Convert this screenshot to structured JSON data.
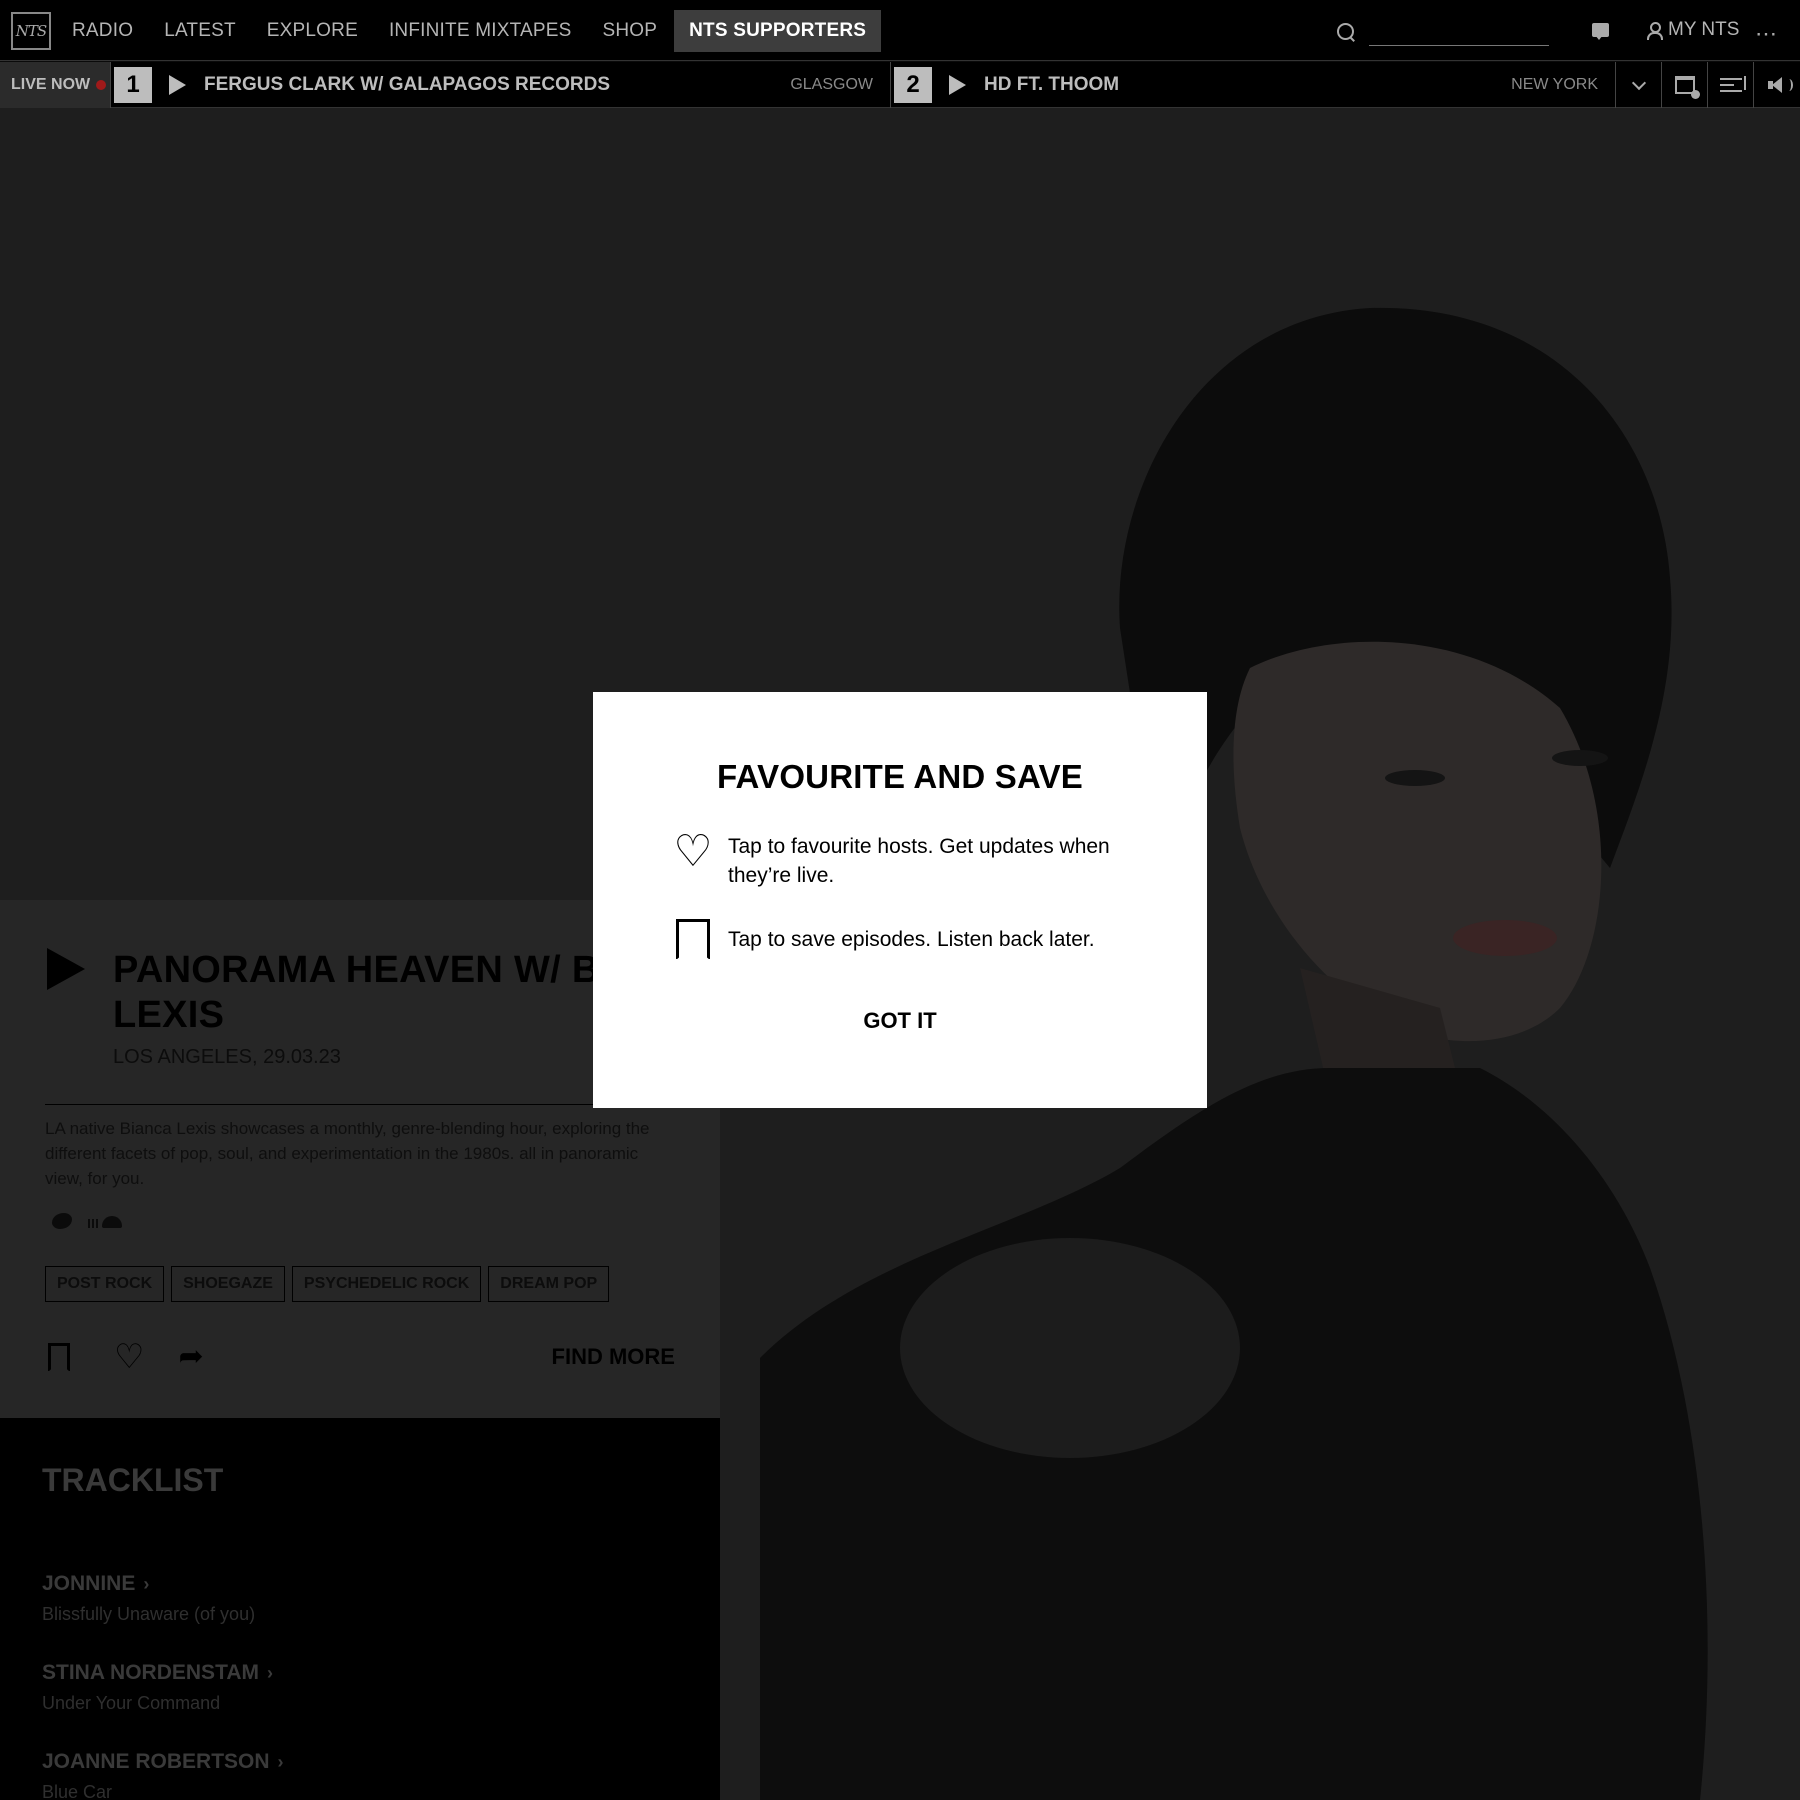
{
  "nav": {
    "logo_text": "NTS",
    "links": [
      "RADIO",
      "LATEST",
      "EXPLORE",
      "INFINITE MIXTAPES",
      "SHOP"
    ],
    "supporters_label": "NTS SUPPORTERS",
    "search_placeholder": "",
    "my_nts_label": "MY NTS",
    "more_icon": "⋯"
  },
  "live_bar": {
    "label": "LIVE NOW",
    "channels": [
      {
        "number": "1",
        "title": "FERGUS CLARK W/ GALAPAGOS RECORDS",
        "location": "GLASGOW"
      },
      {
        "number": "2",
        "title": "HD FT. THOOM",
        "location": "NEW YORK"
      }
    ]
  },
  "episode": {
    "title": "PANORAMA HEAVEN W/ BIANCA LEXIS",
    "title_line1": "PANORAMA HEAVEN W/ BIAN",
    "title_line2": "LEXIS",
    "meta": "LOS ANGELES, 29.03.23",
    "description": "LA native Bianca Lexis showcases a monthly, genre-blending hour, exploring the different facets of pop, soul, and experimentation in the 1980s. all in panoramic view, for you.",
    "tags": [
      "POST ROCK",
      "SHOEGAZE",
      "PSYCHEDELIC ROCK",
      "DREAM POP"
    ],
    "find_more_label": "FIND MORE"
  },
  "tracklist": {
    "heading": "TRACKLIST",
    "tracks": [
      {
        "artist": "JONNINE",
        "title": "Blissfully Unaware (of you)"
      },
      {
        "artist": "STINA NORDENSTAM",
        "title": "Under Your Command"
      },
      {
        "artist": "JOANNE ROBERTSON",
        "title": "Blue Car"
      }
    ]
  },
  "modal": {
    "title": "FAVOURITE AND SAVE",
    "favourite_text": "Tap to favourite hosts. Get updates when they’re live.",
    "save_text": "Tap to save episodes. Listen back later.",
    "button_label": "GOT IT"
  },
  "colors": {
    "background": "#000000",
    "hero_bg": "#1e1e1e",
    "episode_panel": "#262626",
    "modal_bg": "#ffffff",
    "live_dot": "#a01a1a",
    "supporters_bg": "#3d3d3d"
  }
}
